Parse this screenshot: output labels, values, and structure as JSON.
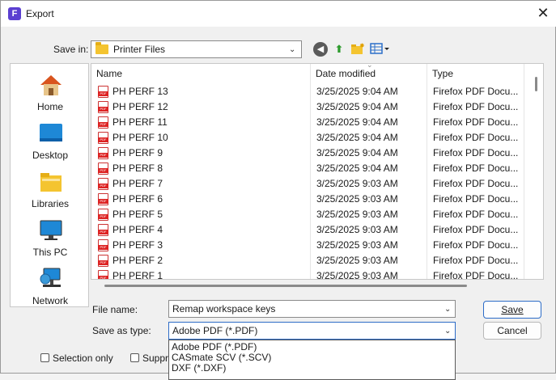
{
  "window": {
    "title": "Export",
    "close": "✕",
    "app_icon_letter": "F"
  },
  "save_in": {
    "label": "Save in:",
    "value": "Printer Files"
  },
  "toolbar": {
    "back": "◀",
    "up": "⬆",
    "new_folder": "📁",
    "view": "▦▾"
  },
  "places": [
    {
      "label": "Home",
      "icon": "home-icon"
    },
    {
      "label": "Desktop",
      "icon": "desktop-icon"
    },
    {
      "label": "Libraries",
      "icon": "libraries-icon"
    },
    {
      "label": "This PC",
      "icon": "computer-icon"
    },
    {
      "label": "Network",
      "icon": "network-icon"
    }
  ],
  "columns": {
    "name": "Name",
    "date": "Date modified",
    "type": "Type"
  },
  "files": [
    {
      "name": "PH PERF 13",
      "date": "3/25/2025 9:04 AM",
      "type": "Firefox PDF Docu..."
    },
    {
      "name": "PH PERF 12",
      "date": "3/25/2025 9:04 AM",
      "type": "Firefox PDF Docu..."
    },
    {
      "name": "PH PERF 11",
      "date": "3/25/2025 9:04 AM",
      "type": "Firefox PDF Docu..."
    },
    {
      "name": "PH PERF 10",
      "date": "3/25/2025 9:04 AM",
      "type": "Firefox PDF Docu..."
    },
    {
      "name": "PH PERF 9",
      "date": "3/25/2025 9:04 AM",
      "type": "Firefox PDF Docu..."
    },
    {
      "name": "PH PERF 8",
      "date": "3/25/2025 9:04 AM",
      "type": "Firefox PDF Docu..."
    },
    {
      "name": "PH PERF 7",
      "date": "3/25/2025 9:03 AM",
      "type": "Firefox PDF Docu..."
    },
    {
      "name": "PH PERF 6",
      "date": "3/25/2025 9:03 AM",
      "type": "Firefox PDF Docu..."
    },
    {
      "name": "PH PERF 5",
      "date": "3/25/2025 9:03 AM",
      "type": "Firefox PDF Docu..."
    },
    {
      "name": "PH PERF 4",
      "date": "3/25/2025 9:03 AM",
      "type": "Firefox PDF Docu..."
    },
    {
      "name": "PH PERF 3",
      "date": "3/25/2025 9:03 AM",
      "type": "Firefox PDF Docu..."
    },
    {
      "name": "PH PERF 2",
      "date": "3/25/2025 9:03 AM",
      "type": "Firefox PDF Docu..."
    },
    {
      "name": "PH PERF 1",
      "date": "3/25/2025 9:03 AM",
      "type": "Firefox PDF Docu..."
    }
  ],
  "file_name": {
    "label": "File name:",
    "value": "Remap workspace keys"
  },
  "save_as_type": {
    "label": "Save as type:",
    "value": "Adobe PDF (*.PDF)",
    "options": [
      "Adobe PDF (*.PDF)",
      "CASmate SCV (*.SCV)",
      "DXF (*.DXF)"
    ]
  },
  "buttons": {
    "save": "Save",
    "cancel": "Cancel"
  },
  "options": {
    "selection_only": "Selection only",
    "suppress": "Suppre"
  }
}
